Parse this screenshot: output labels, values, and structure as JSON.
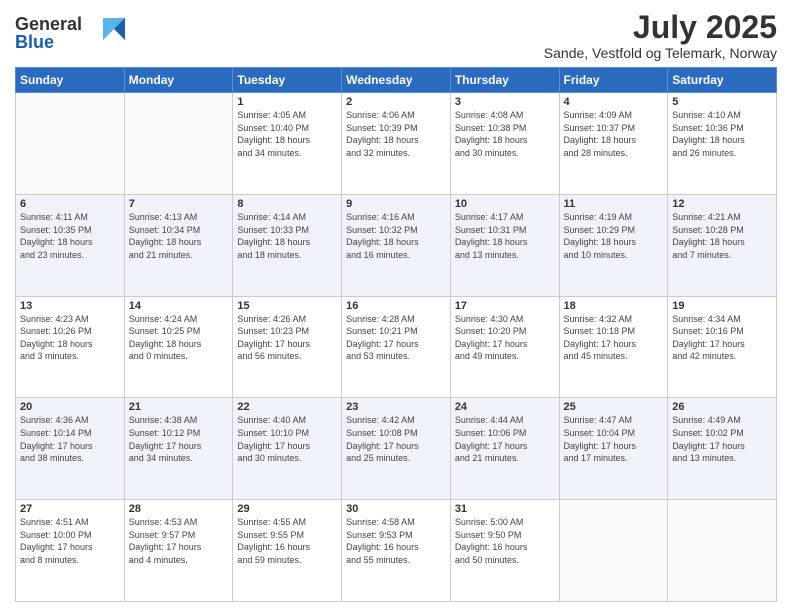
{
  "header": {
    "logo_line1": "General",
    "logo_line2": "Blue",
    "title": "July 2025",
    "subtitle": "Sande, Vestfold og Telemark, Norway"
  },
  "weekdays": [
    "Sunday",
    "Monday",
    "Tuesday",
    "Wednesday",
    "Thursday",
    "Friday",
    "Saturday"
  ],
  "weeks": [
    [
      {
        "day": "",
        "info": ""
      },
      {
        "day": "",
        "info": ""
      },
      {
        "day": "1",
        "info": "Sunrise: 4:05 AM\nSunset: 10:40 PM\nDaylight: 18 hours\nand 34 minutes."
      },
      {
        "day": "2",
        "info": "Sunrise: 4:06 AM\nSunset: 10:39 PM\nDaylight: 18 hours\nand 32 minutes."
      },
      {
        "day": "3",
        "info": "Sunrise: 4:08 AM\nSunset: 10:38 PM\nDaylight: 18 hours\nand 30 minutes."
      },
      {
        "day": "4",
        "info": "Sunrise: 4:09 AM\nSunset: 10:37 PM\nDaylight: 18 hours\nand 28 minutes."
      },
      {
        "day": "5",
        "info": "Sunrise: 4:10 AM\nSunset: 10:36 PM\nDaylight: 18 hours\nand 26 minutes."
      }
    ],
    [
      {
        "day": "6",
        "info": "Sunrise: 4:11 AM\nSunset: 10:35 PM\nDaylight: 18 hours\nand 23 minutes."
      },
      {
        "day": "7",
        "info": "Sunrise: 4:13 AM\nSunset: 10:34 PM\nDaylight: 18 hours\nand 21 minutes."
      },
      {
        "day": "8",
        "info": "Sunrise: 4:14 AM\nSunset: 10:33 PM\nDaylight: 18 hours\nand 18 minutes."
      },
      {
        "day": "9",
        "info": "Sunrise: 4:16 AM\nSunset: 10:32 PM\nDaylight: 18 hours\nand 16 minutes."
      },
      {
        "day": "10",
        "info": "Sunrise: 4:17 AM\nSunset: 10:31 PM\nDaylight: 18 hours\nand 13 minutes."
      },
      {
        "day": "11",
        "info": "Sunrise: 4:19 AM\nSunset: 10:29 PM\nDaylight: 18 hours\nand 10 minutes."
      },
      {
        "day": "12",
        "info": "Sunrise: 4:21 AM\nSunset: 10:28 PM\nDaylight: 18 hours\nand 7 minutes."
      }
    ],
    [
      {
        "day": "13",
        "info": "Sunrise: 4:23 AM\nSunset: 10:26 PM\nDaylight: 18 hours\nand 3 minutes."
      },
      {
        "day": "14",
        "info": "Sunrise: 4:24 AM\nSunset: 10:25 PM\nDaylight: 18 hours\nand 0 minutes."
      },
      {
        "day": "15",
        "info": "Sunrise: 4:26 AM\nSunset: 10:23 PM\nDaylight: 17 hours\nand 56 minutes."
      },
      {
        "day": "16",
        "info": "Sunrise: 4:28 AM\nSunset: 10:21 PM\nDaylight: 17 hours\nand 53 minutes."
      },
      {
        "day": "17",
        "info": "Sunrise: 4:30 AM\nSunset: 10:20 PM\nDaylight: 17 hours\nand 49 minutes."
      },
      {
        "day": "18",
        "info": "Sunrise: 4:32 AM\nSunset: 10:18 PM\nDaylight: 17 hours\nand 45 minutes."
      },
      {
        "day": "19",
        "info": "Sunrise: 4:34 AM\nSunset: 10:16 PM\nDaylight: 17 hours\nand 42 minutes."
      }
    ],
    [
      {
        "day": "20",
        "info": "Sunrise: 4:36 AM\nSunset: 10:14 PM\nDaylight: 17 hours\nand 38 minutes."
      },
      {
        "day": "21",
        "info": "Sunrise: 4:38 AM\nSunset: 10:12 PM\nDaylight: 17 hours\nand 34 minutes."
      },
      {
        "day": "22",
        "info": "Sunrise: 4:40 AM\nSunset: 10:10 PM\nDaylight: 17 hours\nand 30 minutes."
      },
      {
        "day": "23",
        "info": "Sunrise: 4:42 AM\nSunset: 10:08 PM\nDaylight: 17 hours\nand 25 minutes."
      },
      {
        "day": "24",
        "info": "Sunrise: 4:44 AM\nSunset: 10:06 PM\nDaylight: 17 hours\nand 21 minutes."
      },
      {
        "day": "25",
        "info": "Sunrise: 4:47 AM\nSunset: 10:04 PM\nDaylight: 17 hours\nand 17 minutes."
      },
      {
        "day": "26",
        "info": "Sunrise: 4:49 AM\nSunset: 10:02 PM\nDaylight: 17 hours\nand 13 minutes."
      }
    ],
    [
      {
        "day": "27",
        "info": "Sunrise: 4:51 AM\nSunset: 10:00 PM\nDaylight: 17 hours\nand 8 minutes."
      },
      {
        "day": "28",
        "info": "Sunrise: 4:53 AM\nSunset: 9:57 PM\nDaylight: 17 hours\nand 4 minutes."
      },
      {
        "day": "29",
        "info": "Sunrise: 4:55 AM\nSunset: 9:55 PM\nDaylight: 16 hours\nand 59 minutes."
      },
      {
        "day": "30",
        "info": "Sunrise: 4:58 AM\nSunset: 9:53 PM\nDaylight: 16 hours\nand 55 minutes."
      },
      {
        "day": "31",
        "info": "Sunrise: 5:00 AM\nSunset: 9:50 PM\nDaylight: 16 hours\nand 50 minutes."
      },
      {
        "day": "",
        "info": ""
      },
      {
        "day": "",
        "info": ""
      }
    ]
  ]
}
